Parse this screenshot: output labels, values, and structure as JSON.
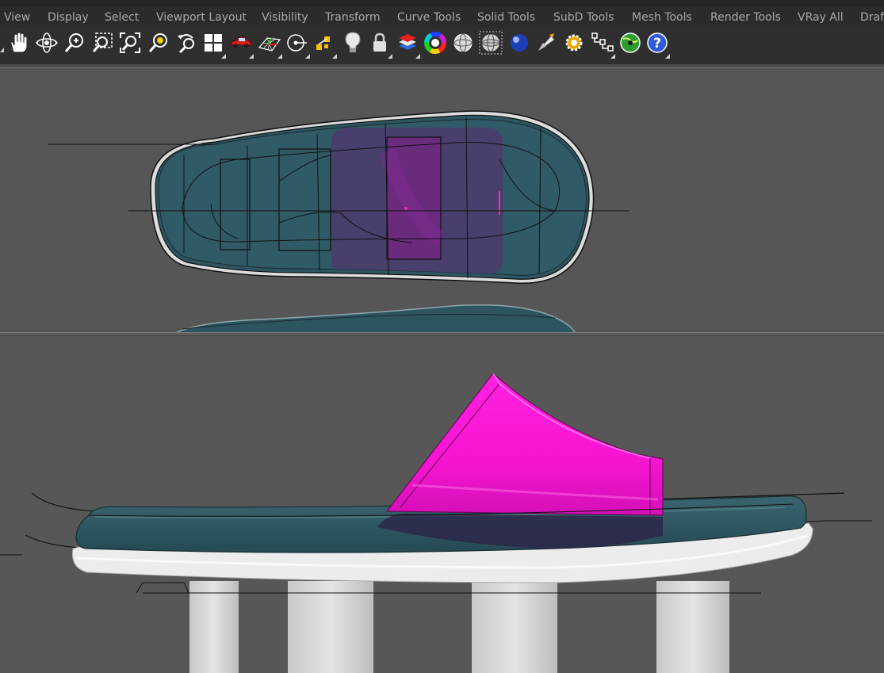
{
  "menu": {
    "items": [
      "View",
      "Display",
      "Select",
      "Viewport Layout",
      "Visibility",
      "Transform",
      "Curve Tools",
      "Solid Tools",
      "SubD Tools",
      "Mesh Tools",
      "Render Tools",
      "VRay All",
      "Drafti"
    ]
  },
  "toolbar": {
    "icons": [
      "pan-hand-icon",
      "rotate-view-icon",
      "zoom-icon",
      "zoom-window-icon",
      "zoom-extents-icon",
      "zoom-selected-icon",
      "undo-view-icon",
      "four-viewports-icon",
      "shaded-car-icon",
      "grid-plane-icon",
      "osnap-icon",
      "gumball-icon",
      "light-bulb-icon",
      "lock-icon",
      "layers-icon",
      "color-wheel-icon",
      "wireframe-sphere-icon",
      "mesh-sphere-icon",
      "render-sphere-icon",
      "render-icon",
      "options-gear-icon",
      "history-tree-icon",
      "globe-plugin-icon",
      "help-icon"
    ]
  },
  "colors": {
    "sole_teal": "#2e5560",
    "strap_magenta": "#ff18d4",
    "outsole_white": "#eaeaea",
    "viewport_bg": "#565656"
  }
}
